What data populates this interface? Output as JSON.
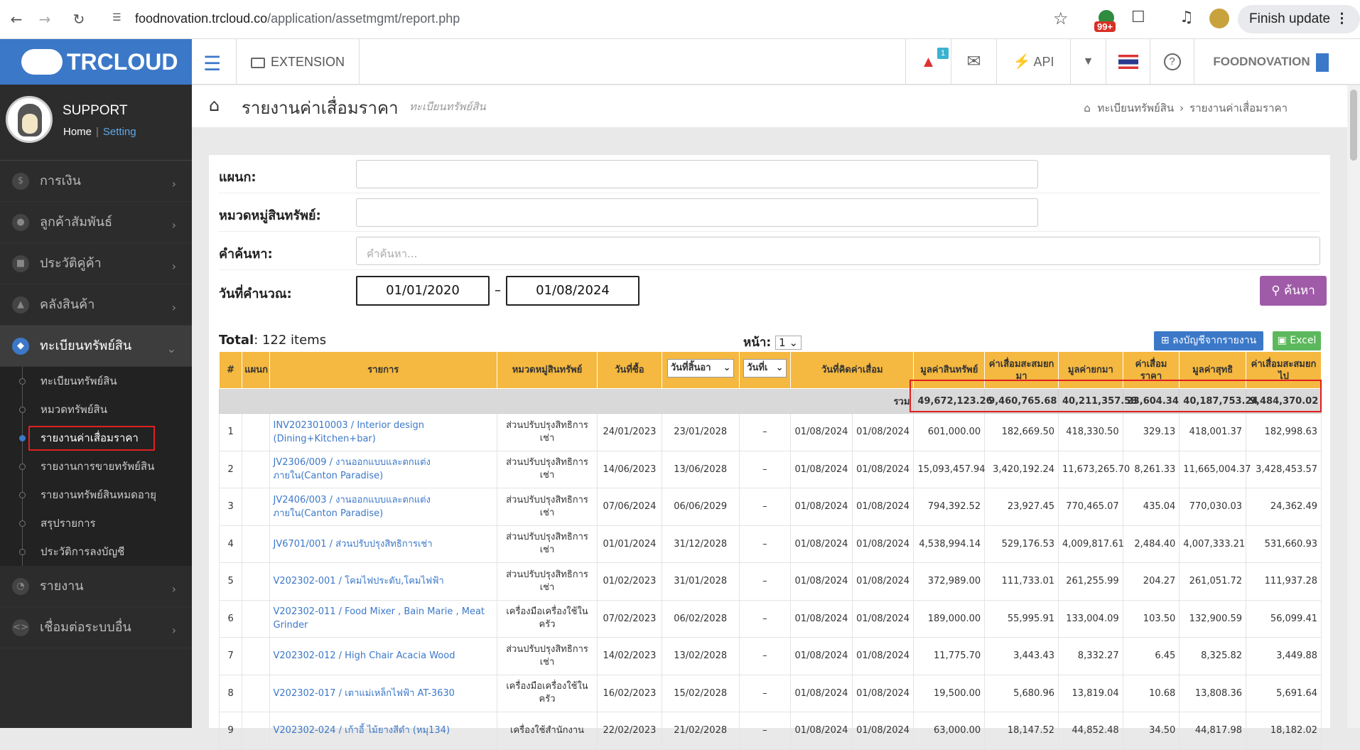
{
  "browser": {
    "url_host": "foodnovation.trcloud.co",
    "url_path": "/application/assetmgmt/report.php",
    "ext_badge": "99+",
    "finish_update": "Finish update"
  },
  "sidebar": {
    "logo": "TRCLOUD",
    "user_name": "SUPPORT",
    "home_link": "Home",
    "setting_link": "Setting",
    "items": [
      {
        "label": "การเงิน"
      },
      {
        "label": "ลูกค้าสัมพันธ์"
      },
      {
        "label": "ประวัติคู่ค้า"
      },
      {
        "label": "คลังสินค้า"
      },
      {
        "label": "ทะเบียนทรัพย์สิน"
      },
      {
        "label": "รายงาน"
      },
      {
        "label": "เชื่อมต่อระบบอื่น"
      }
    ],
    "sub_items": [
      {
        "label": "ทะเบียนทรัพย์สิน"
      },
      {
        "label": "หมวดทรัพย์สิน"
      },
      {
        "label": "รายงานค่าเสื่อมราคา"
      },
      {
        "label": "รายงานการขายทรัพย์สิน"
      },
      {
        "label": "รายงานทรัพย์สินหมดอายุ"
      },
      {
        "label": "สรุปรายการ"
      },
      {
        "label": "ประวัติการลงบัญชี"
      }
    ]
  },
  "topbar": {
    "extension": "EXTENSION",
    "notice_count": "1",
    "api": "API",
    "company": "FOODNOVATION"
  },
  "page": {
    "title": "รายงานค่าเสื่อมราคา",
    "subtitle": "ทะเบียนทรัพย์สิน",
    "breadcrumb": [
      "ทะเบียนทรัพย์สิน",
      "รายงานค่าเสื่อมราคา"
    ]
  },
  "filters": {
    "department_label": "แผนก:",
    "category_label": "หมวดหมู่สินทรัพย์:",
    "search_label": "คำค้นหา:",
    "search_placeholder": "คำค้นหา...",
    "date_label": "วันที่คำนวณ:",
    "date_from": "01/01/2020",
    "date_sep": "–",
    "date_to": "01/08/2024",
    "search_button": "ค้นหา"
  },
  "report": {
    "total_label": "Total",
    "total_value": ": 122 items",
    "page_label": "หน้า:",
    "page_value": "1",
    "post_button": "ลงบัญชีจากรายงาน",
    "excel_button": "Excel",
    "columns": [
      "#",
      "แผนก",
      "รายการ",
      "หมวดหมู่สินทรัพย์",
      "วันที่ซื้อ",
      "วันที่สิ้นอา",
      "วันที่เ",
      "วันที่คิดค่าเสื่อม",
      "มูลค่าสินทรัพย์",
      "ค่าเสื่อมสะสมยกมา",
      "มูลค่ายกมา",
      "ค่าเสื่อมราคา",
      "มูลค่าสุทธิ",
      "ค่าเสื่อมสะสมยกไป"
    ],
    "sum_label": "รวม",
    "sum": [
      "49,672,123.26",
      "9,460,765.68",
      "40,211,357.58",
      "23,604.34",
      "40,187,753.24",
      "9,484,370.02"
    ],
    "rows": [
      {
        "no": "1",
        "name": "INV2023010003 / Interior design (Dining+Kitchen+bar)",
        "cat": "ส่วนปรับปรุงสิทธิการเช่า",
        "buy": "24/01/2023",
        "end": "23/01/2028",
        "dash": "–",
        "d1": "01/08/2024",
        "d2": "01/08/2024",
        "v1": "601,000.00",
        "v2": "182,669.50",
        "v3": "418,330.50",
        "v4": "329.13",
        "v5": "418,001.37",
        "v6": "182,998.63"
      },
      {
        "no": "2",
        "name": "JV2306/009 / งานออกแบบและตกแต่งภายใน(Canton Paradise)",
        "cat": "ส่วนปรับปรุงสิทธิการเช่า",
        "buy": "14/06/2023",
        "end": "13/06/2028",
        "dash": "–",
        "d1": "01/08/2024",
        "d2": "01/08/2024",
        "v1": "15,093,457.94",
        "v2": "3,420,192.24",
        "v3": "11,673,265.70",
        "v4": "8,261.33",
        "v5": "11,665,004.37",
        "v6": "3,428,453.57"
      },
      {
        "no": "3",
        "name": "JV2406/003 / งานออกแบบและตกแต่งภายใน(Canton Paradise)",
        "cat": "ส่วนปรับปรุงสิทธิการเช่า",
        "buy": "07/06/2024",
        "end": "06/06/2029",
        "dash": "–",
        "d1": "01/08/2024",
        "d2": "01/08/2024",
        "v1": "794,392.52",
        "v2": "23,927.45",
        "v3": "770,465.07",
        "v4": "435.04",
        "v5": "770,030.03",
        "v6": "24,362.49"
      },
      {
        "no": "4",
        "name": "JV6701/001 / ส่วนปรับปรุงสิทธิการเช่า",
        "cat": "ส่วนปรับปรุงสิทธิการเช่า",
        "buy": "01/01/2024",
        "end": "31/12/2028",
        "dash": "–",
        "d1": "01/08/2024",
        "d2": "01/08/2024",
        "v1": "4,538,994.14",
        "v2": "529,176.53",
        "v3": "4,009,817.61",
        "v4": "2,484.40",
        "v5": "4,007,333.21",
        "v6": "531,660.93"
      },
      {
        "no": "5",
        "name": "V202302-001 / โคมไฟประดับ,โคมไฟฟ้า",
        "cat": "ส่วนปรับปรุงสิทธิการเช่า",
        "buy": "01/02/2023",
        "end": "31/01/2028",
        "dash": "–",
        "d1": "01/08/2024",
        "d2": "01/08/2024",
        "v1": "372,989.00",
        "v2": "111,733.01",
        "v3": "261,255.99",
        "v4": "204.27",
        "v5": "261,051.72",
        "v6": "111,937.28"
      },
      {
        "no": "6",
        "name": "V202302-011 / Food Mixer , Bain Marie , Meat Grinder",
        "cat": "เครื่องมือเครื่องใช้ในครัว",
        "buy": "07/02/2023",
        "end": "06/02/2028",
        "dash": "–",
        "d1": "01/08/2024",
        "d2": "01/08/2024",
        "v1": "189,000.00",
        "v2": "55,995.91",
        "v3": "133,004.09",
        "v4": "103.50",
        "v5": "132,900.59",
        "v6": "56,099.41"
      },
      {
        "no": "7",
        "name": "V202302-012 / High Chair Acacia Wood",
        "cat": "ส่วนปรับปรุงสิทธิการเช่า",
        "buy": "14/02/2023",
        "end": "13/02/2028",
        "dash": "–",
        "d1": "01/08/2024",
        "d2": "01/08/2024",
        "v1": "11,775.70",
        "v2": "3,443.43",
        "v3": "8,332.27",
        "v4": "6.45",
        "v5": "8,325.82",
        "v6": "3,449.88"
      },
      {
        "no": "8",
        "name": "V202302-017 / เตาแม่เหล็กไฟฟ้า AT-3630",
        "cat": "เครื่องมือเครื่องใช้ในครัว",
        "buy": "16/02/2023",
        "end": "15/02/2028",
        "dash": "–",
        "d1": "01/08/2024",
        "d2": "01/08/2024",
        "v1": "19,500.00",
        "v2": "5,680.96",
        "v3": "13,819.04",
        "v4": "10.68",
        "v5": "13,808.36",
        "v6": "5,691.64"
      },
      {
        "no": "9",
        "name": "V202302-024 / เก้าอี้ ไม้ยางสีดำ (หมุ134)",
        "cat": "เครื่องใช้สำนักงาน",
        "buy": "22/02/2023",
        "end": "21/02/2028",
        "dash": "–",
        "d1": "01/08/2024",
        "d2": "01/08/2024",
        "v1": "63,000.00",
        "v2": "18,147.52",
        "v3": "44,852.48",
        "v4": "34.50",
        "v5": "44,817.98",
        "v6": "18,182.02"
      }
    ]
  },
  "colors": {
    "brand": "#3c78c8",
    "header": "#f5b840",
    "search": "#a05ba8",
    "excel": "#5cb85c",
    "highlight": "#e02020"
  }
}
